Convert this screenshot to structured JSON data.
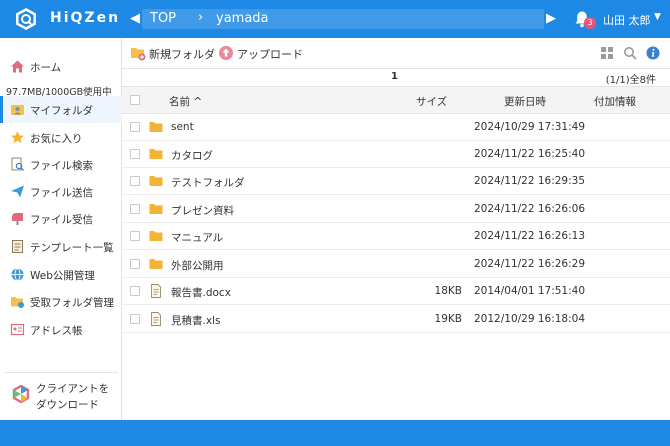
{
  "app": {
    "name": "HiQZen"
  },
  "breadcrumb": {
    "root": "TOP",
    "separator": "›",
    "current": "yamada",
    "prev_arrow": "◀",
    "next_arrow": "▶"
  },
  "notifications": {
    "count": "3"
  },
  "user": {
    "name": "山田 太郎",
    "caret": "▼"
  },
  "sidebar": {
    "quota": "97.7MB/1000GB使用中",
    "items": [
      {
        "label": "ホーム",
        "icon": "home-icon"
      },
      {
        "label": "マイフォルダ",
        "icon": "my-folder-icon",
        "active": true
      },
      {
        "label": "お気に入り",
        "icon": "star-icon"
      },
      {
        "label": "ファイル検索",
        "icon": "file-search-icon"
      },
      {
        "label": "ファイル送信",
        "icon": "send-icon"
      },
      {
        "label": "ファイル受信",
        "icon": "mailbox-icon"
      },
      {
        "label": "テンプレート一覧",
        "icon": "template-icon"
      },
      {
        "label": "Web公開管理",
        "icon": "globe-icon"
      },
      {
        "label": "受取フォルダ管理",
        "icon": "receive-folder-icon"
      },
      {
        "label": "アドレス帳",
        "icon": "address-book-icon"
      }
    ],
    "client_download": {
      "line1": "クライアントを",
      "line2": "ダウンロード"
    }
  },
  "toolbar": {
    "new_folder": "新規フォルダ",
    "upload": "アップロード"
  },
  "pager": {
    "page": "1",
    "count": "(1/1)全8件"
  },
  "table": {
    "headers": {
      "name": "名前",
      "sort_indicator": "^",
      "size": "サイズ",
      "updated": "更新日時",
      "extra": "付加情報"
    },
    "rows": [
      {
        "type": "folder",
        "name": "sent",
        "size": "",
        "date": "2024/10/29 17:31:49"
      },
      {
        "type": "folder",
        "name": "カタログ",
        "size": "",
        "date": "2024/11/22 16:25:40"
      },
      {
        "type": "folder",
        "name": "テストフォルダ",
        "size": "",
        "date": "2024/11/22 16:29:35"
      },
      {
        "type": "folder",
        "name": "プレゼン資料",
        "size": "",
        "date": "2024/11/22 16:26:06"
      },
      {
        "type": "folder",
        "name": "マニュアル",
        "size": "",
        "date": "2024/11/22 16:26:13"
      },
      {
        "type": "folder",
        "name": "外部公開用",
        "size": "",
        "date": "2024/11/22 16:26:29"
      },
      {
        "type": "file",
        "name": "報告書.docx",
        "size": "18KB",
        "date": "2014/04/01 17:51:40"
      },
      {
        "type": "file",
        "name": "見積書.xls",
        "size": "19KB",
        "date": "2012/10/29 16:18:04"
      }
    ]
  },
  "colors": {
    "primary": "#1e88e5",
    "folder": "#f5b335",
    "badge": "#e6557a"
  }
}
